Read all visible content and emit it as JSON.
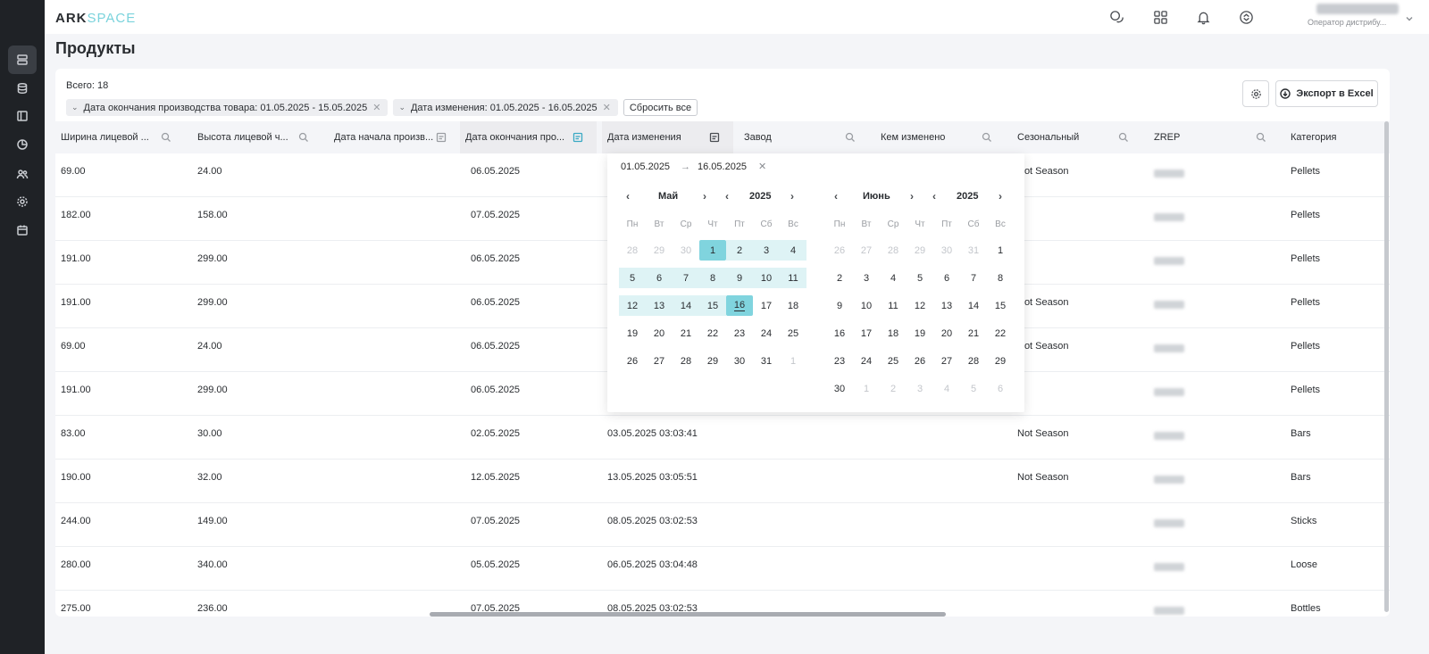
{
  "header": {
    "logo_a": "ARK",
    "logo_b": "SPACE",
    "user_role": "Оператор дистрибу..."
  },
  "page": {
    "title": "Продукты"
  },
  "toolbar": {
    "total": "Всего: 18",
    "filters": [
      "Дата окончания производства товара: 01.05.2025 - 15.05.2025",
      "Дата изменения: 01.05.2025 - 16.05.2025"
    ],
    "reset_label": "Сбросить все",
    "export_label": "Экспорт в Excel"
  },
  "table": {
    "columns": [
      "Ширина лицевой ...",
      "Высота лицевой ч...",
      "Дата начала произв...",
      "Дата окончания про...",
      "Дата изменения",
      "Завод",
      "Кем изменено",
      "Сезональный",
      "ZREP",
      "Категория"
    ],
    "rows": [
      {
        "width": "69.00",
        "height": "24.00",
        "end": "06.05.2025",
        "changed": "",
        "season": "Not Season",
        "category": "Pellets"
      },
      {
        "width": "182.00",
        "height": "158.00",
        "end": "07.05.2025",
        "changed": "",
        "season": "",
        "category": "Pellets"
      },
      {
        "width": "191.00",
        "height": "299.00",
        "end": "06.05.2025",
        "changed": "",
        "season": "",
        "category": "Pellets"
      },
      {
        "width": "191.00",
        "height": "299.00",
        "end": "06.05.2025",
        "changed": "",
        "season": "Not Season",
        "category": "Pellets"
      },
      {
        "width": "69.00",
        "height": "24.00",
        "end": "06.05.2025",
        "changed": "",
        "season": "Not Season",
        "category": "Pellets"
      },
      {
        "width": "191.00",
        "height": "299.00",
        "end": "06.05.2025",
        "changed": "",
        "season": "",
        "category": "Pellets"
      },
      {
        "width": "83.00",
        "height": "30.00",
        "end": "02.05.2025",
        "changed": "03.05.2025 03:03:41",
        "season": "Not Season",
        "category": "Bars"
      },
      {
        "width": "190.00",
        "height": "32.00",
        "end": "12.05.2025",
        "changed": "13.05.2025 03:05:51",
        "season": "Not Season",
        "category": "Bars"
      },
      {
        "width": "244.00",
        "height": "149.00",
        "end": "07.05.2025",
        "changed": "08.05.2025 03:02:53",
        "season": "",
        "category": "Sticks"
      },
      {
        "width": "280.00",
        "height": "340.00",
        "end": "05.05.2025",
        "changed": "06.05.2025 03:04:48",
        "season": "",
        "category": "Loose"
      },
      {
        "width": "275.00",
        "height": "236.00",
        "end": "07.05.2025",
        "changed": "08.05.2025 03:02:53",
        "season": "",
        "category": "Bottles"
      }
    ]
  },
  "datepicker": {
    "from": "01.05.2025",
    "to": "16.05.2025",
    "weekdays": [
      "Пн",
      "Вт",
      "Ср",
      "Чт",
      "Пт",
      "Сб",
      "Вс"
    ],
    "left": {
      "month": "Май",
      "year": "2025",
      "days": [
        "28",
        "29",
        "30",
        "1",
        "2",
        "3",
        "4",
        "5",
        "6",
        "7",
        "8",
        "9",
        "10",
        "11",
        "12",
        "13",
        "14",
        "15",
        "16",
        "17",
        "18",
        "19",
        "20",
        "21",
        "22",
        "23",
        "24",
        "25",
        "26",
        "27",
        "28",
        "29",
        "30",
        "31",
        "1"
      ]
    },
    "right": {
      "month": "Июнь",
      "year": "2025",
      "days": [
        "26",
        "27",
        "28",
        "29",
        "30",
        "31",
        "1",
        "2",
        "3",
        "4",
        "5",
        "6",
        "7",
        "8",
        "9",
        "10",
        "11",
        "12",
        "13",
        "14",
        "15",
        "16",
        "17",
        "18",
        "19",
        "20",
        "21",
        "22",
        "23",
        "24",
        "25",
        "26",
        "27",
        "28",
        "29",
        "30",
        "1",
        "2",
        "3",
        "4",
        "5",
        "6"
      ]
    }
  },
  "colors": {
    "range": "#def3f5",
    "edge": "#80d4de",
    "sidebar": "#1f2226"
  }
}
